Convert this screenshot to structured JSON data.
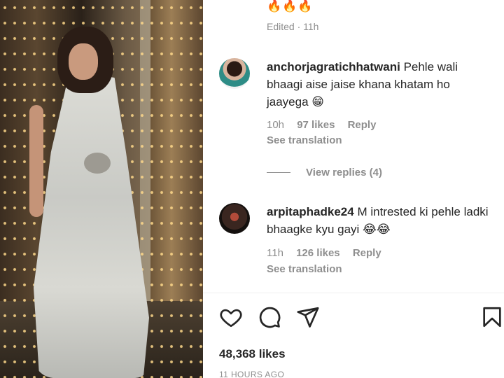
{
  "caption": {
    "emoji": "🔥🔥🔥",
    "edited": "Edited · 11h"
  },
  "comments": [
    {
      "username": "anchorjagratichhatwani",
      "text": "Pehle wali bhaagi aise jaise khana khatam ho jaayega 😁",
      "time": "10h",
      "likes": "97 likes",
      "reply": "Reply",
      "translation": "See translation"
    },
    {
      "username": "arpitaphadke24",
      "text": "M intrested ki pehle ladki bhaagke kyu gayi 😂😂",
      "time": "11h",
      "likes": "126 likes",
      "reply": "Reply",
      "translation": "See translation"
    }
  ],
  "view_replies": "View replies (4)",
  "post": {
    "likes": "48,368 likes",
    "timestamp": "11 HOURS AGO"
  },
  "icons": {
    "like": "heart-icon",
    "comment": "comment-icon",
    "share": "send-icon",
    "save": "bookmark-icon",
    "comment_like": "heart-icon"
  },
  "colors": {
    "text": "#262626",
    "secondary": "#8e8e8e",
    "divider": "#efefef"
  }
}
